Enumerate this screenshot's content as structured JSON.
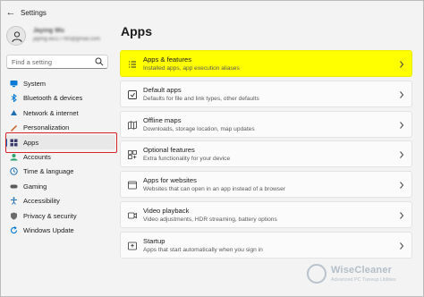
{
  "window": {
    "title": "Settings",
    "back_icon": "back-arrow-icon"
  },
  "profile": {
    "name": "Jaying Wu",
    "email": "jaying.wu17790@gmail.com"
  },
  "search": {
    "placeholder": "Find a setting"
  },
  "nav": {
    "items": [
      {
        "label": "System",
        "icon": "monitor-icon",
        "color": "#0078d4"
      },
      {
        "label": "Bluetooth & devices",
        "icon": "bluetooth-icon",
        "color": "#0078d4"
      },
      {
        "label": "Network & internet",
        "icon": "network-icon",
        "color": "#1f6fb5"
      },
      {
        "label": "Personalization",
        "icon": "brush-icon",
        "color": "#c45a1a"
      },
      {
        "label": "Apps",
        "icon": "apps-icon",
        "color": "#3b3b6b",
        "active": true
      },
      {
        "label": "Accounts",
        "icon": "accounts-icon",
        "color": "#2aa36b"
      },
      {
        "label": "Time & language",
        "icon": "globe-clock-icon",
        "color": "#1f6fb5"
      },
      {
        "label": "Gaming",
        "icon": "gamepad-icon",
        "color": "#5a5a5a"
      },
      {
        "label": "Accessibility",
        "icon": "accessibility-icon",
        "color": "#1f6fb5"
      },
      {
        "label": "Privacy & security",
        "icon": "shield-icon",
        "color": "#6b6b6b"
      },
      {
        "label": "Windows Update",
        "icon": "update-icon",
        "color": "#0078d4"
      }
    ]
  },
  "main": {
    "title": "Apps",
    "cards": [
      {
        "title": "Apps & features",
        "subtitle": "Installed apps, app execution aliases",
        "icon": "list-icon",
        "highlight": true
      },
      {
        "title": "Default apps",
        "subtitle": "Defaults for file and link types, other defaults",
        "icon": "default-apps-icon"
      },
      {
        "title": "Offline maps",
        "subtitle": "Downloads, storage location, map updates",
        "icon": "map-icon"
      },
      {
        "title": "Optional features",
        "subtitle": "Extra functionality for your device",
        "icon": "optional-features-icon"
      },
      {
        "title": "Apps for websites",
        "subtitle": "Websites that can open in an app instead of a browser",
        "icon": "app-website-icon"
      },
      {
        "title": "Video playback",
        "subtitle": "Video adjustments, HDR streaming, battery options",
        "icon": "video-icon"
      },
      {
        "title": "Startup",
        "subtitle": "Apps that start automatically when you sign in",
        "icon": "startup-icon"
      }
    ]
  },
  "watermark": {
    "brand": "WiseCleaner",
    "tagline": "Advanced PC Tuneup Utilities"
  },
  "colors": {
    "highlight": "#ffff00",
    "accent": "#0067c0",
    "annotation_box": "#d9252a"
  }
}
